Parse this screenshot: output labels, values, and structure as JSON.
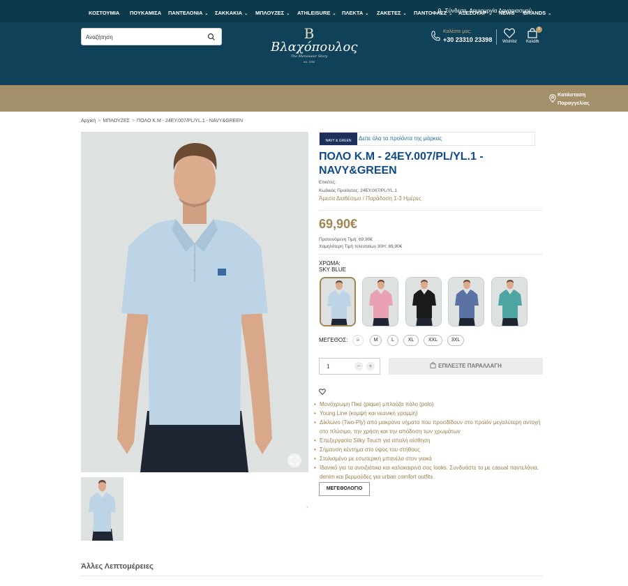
{
  "topbar": {
    "login": "Σύνδεση",
    "register": "Δημιουργία Λογαριασμού"
  },
  "header": {
    "search_placeholder": "Αναζήτηση",
    "logo": {
      "mono": "B",
      "name": "Βλαχόπουλος",
      "tagline": "The Menswear Story",
      "est": "est. 1955"
    },
    "phone_label": "Καλέστε μας:",
    "phone_number": "+30 23310 23398",
    "wishlist_label": "Wishlist",
    "cart_label": "Καλάθι",
    "cart_count": "0"
  },
  "nav": {
    "items": [
      {
        "label": "ΚΟΣΤΟΥΜΙΑ",
        "dropdown": false
      },
      {
        "label": "ΠΟΥΚΑΜΙΣΑ",
        "dropdown": false
      },
      {
        "label": "ΠΑΝΤΕΛΟΝΙΑ",
        "dropdown": true
      },
      {
        "label": "ΣΑΚΚΑΚΙΑ",
        "dropdown": true
      },
      {
        "label": "ΜΠΛΟΥΖΕΣ",
        "dropdown": true
      },
      {
        "label": "ATHLEISURE",
        "dropdown": true
      },
      {
        "label": "ΠΛΕΚΤΑ",
        "dropdown": true
      },
      {
        "label": "ΖΑΚΕΤΕΣ",
        "dropdown": true
      },
      {
        "label": "ΠΑΝΤΟΦΛΕΣ",
        "dropdown": true
      },
      {
        "label": "ΑΞΕΣΟΥΑΡ",
        "dropdown": true
      },
      {
        "label": "NEWS",
        "dropdown": false
      },
      {
        "label": "BRANDS",
        "dropdown": true
      }
    ],
    "order_status_line1": "Κατάσταση",
    "order_status_line2": "Παραγγελίας"
  },
  "breadcrumb": {
    "home": "Αρχική",
    "category": "ΜΠΛΟΥΖΕΣ",
    "current": "ΠΟΛΟ Κ.Μ - 24ΕΥ.007/PL/YL.1 - NAVY&GREEN"
  },
  "product": {
    "brand_logo_text": "NAVY & GREEN",
    "brand_link": "Δείτε όλα τα προϊόντα της μάρκας",
    "title": "ΠΟΛΟ Κ.Μ - 24ΕΥ.007/PL/YL.1 - NAVY&GREEN",
    "tags_label": "Ετικέτες:",
    "code_label": "Κωδικός Προϊόντος:",
    "code": "24ΕΥ.007/PL/YL.1",
    "availability": "Άμεσα Διαθέσιμο / Παράδοση 1-3 Ημέρες",
    "price": "69,90€",
    "recommended_price": "Προτεινόμενη Τιμή: 69,90€",
    "lowest_price": "Χαμηλότερη Τιμή τελευταίων 30Η: 69,90€",
    "color_label": "ΧΡΩΜΑ:",
    "color_value": "SKY BLUE",
    "swatch_colors": [
      "#bcd4e6",
      "#e8a2b3",
      "#1a1a1a",
      "#5b72a4",
      "#4fa5a2"
    ],
    "size_label": "ΜΕΓΕΘΟΣ:",
    "sizes": [
      "S",
      "M",
      "L",
      "XL",
      "XXL",
      "3XL"
    ],
    "quantity": "1",
    "qty_minus": "−",
    "qty_plus": "+",
    "add_button": "ΕΠΙΛΕΞΤΕ ΠΑΡΑΛΛΑΓΗ",
    "bullets": [
      "Μονόχρωμη Πικέ (pique) μπλούζα πόλο (polo)",
      "Young Line (κομψή και νεανική γραμμή)",
      "Δίκλωνο (Two-Ply) από μακράνα νήματα που προσδίδουν στο προϊόν μεγαλύτερη αντοχή στο πλύσιμο, την χρήση και την απόδοση των χρωμάτων",
      "Επεξεργασία Silky Touch για απαλή αίσθηση",
      "Σήμανση κέντημα στο ύψος του στήθους",
      "Στολισμένο με εσωτερική μπανέλα στον γιακά",
      "Ιδανικό για τα ανοιξιάτικα και καλοκαιρινά σας looks. Συνδυάστε το με casual παντελόνια, denim και βερμούδες για urban comfort outfits"
    ],
    "size_guide_button": "ΜΕΓΕΘΟΛΟΓΙΟ"
  },
  "details_heading": "Άλλες Λεπτομέρειες",
  "colors": {
    "header": "#0f4258",
    "nav": "#a3906a",
    "accent": "#a08552",
    "title": "#0f4a8a"
  }
}
